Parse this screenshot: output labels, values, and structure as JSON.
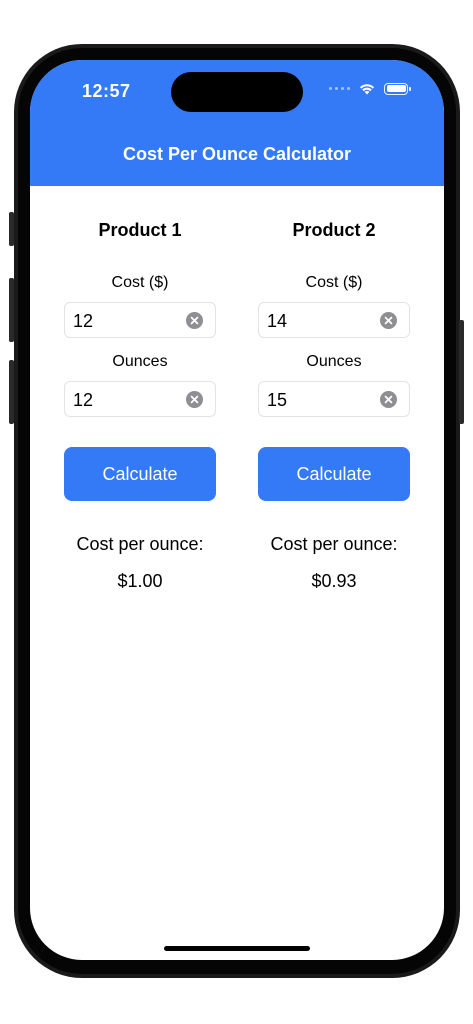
{
  "status_bar": {
    "time": "12:57",
    "icons": [
      "signal-dots-icon",
      "wifi-icon",
      "battery-icon"
    ]
  },
  "header": {
    "title": "Cost Per Ounce Calculator"
  },
  "products": [
    {
      "title": "Product 1",
      "cost_label": "Cost ($)",
      "cost_value": "12",
      "ounces_label": "Ounces",
      "ounces_value": "12",
      "button_label": "Calculate",
      "result_label": "Cost per ounce:",
      "result_value": "$1.00"
    },
    {
      "title": "Product 2",
      "cost_label": "Cost ($)",
      "cost_value": "14",
      "ounces_label": "Ounces",
      "ounces_value": "15",
      "button_label": "Calculate",
      "result_label": "Cost per ounce:",
      "result_value": "$0.93"
    }
  ],
  "colors": {
    "accent": "#3479f6",
    "clear_button": "#8e8e93",
    "field_border": "#e3e3e6"
  }
}
